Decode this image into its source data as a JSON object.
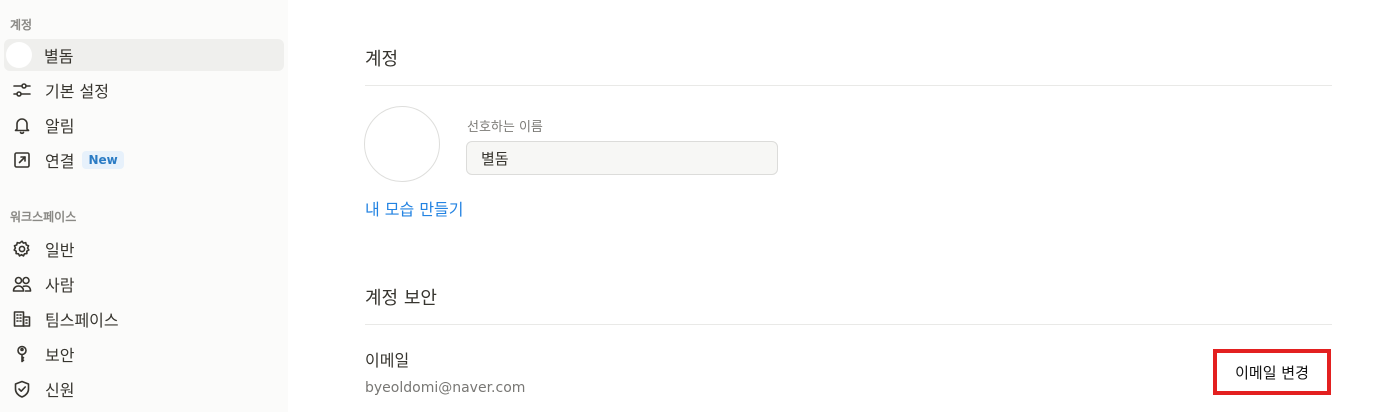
{
  "sidebar": {
    "account_section": "계정",
    "workspace_section": "워크스페이스",
    "account_items": [
      {
        "label": "별돔",
        "icon": "avatar"
      },
      {
        "label": "기본 설정",
        "icon": "sliders-icon"
      },
      {
        "label": "알림",
        "icon": "bell-icon"
      },
      {
        "label": "연결",
        "icon": "external-link-icon",
        "badge": "New"
      }
    ],
    "workspace_items": [
      {
        "label": "일반",
        "icon": "gear-icon"
      },
      {
        "label": "사람",
        "icon": "people-icon"
      },
      {
        "label": "팀스페이스",
        "icon": "building-icon"
      },
      {
        "label": "보안",
        "icon": "key-icon"
      },
      {
        "label": "신원",
        "icon": "shield-check-icon"
      }
    ]
  },
  "main": {
    "account_title": "계정",
    "preferred_name_label": "선호하는 이름",
    "preferred_name_value": "별돔",
    "create_avatar_link": "내 모습 만들기",
    "security_title": "계정 보안",
    "email_label": "이메일",
    "email_value": "byeoldomi@naver.com",
    "change_email_button": "이메일 변경"
  },
  "colors": {
    "accent_blue": "#2383e2",
    "highlight_red": "#e32020",
    "sidebar_bg": "#fbfbfa"
  }
}
